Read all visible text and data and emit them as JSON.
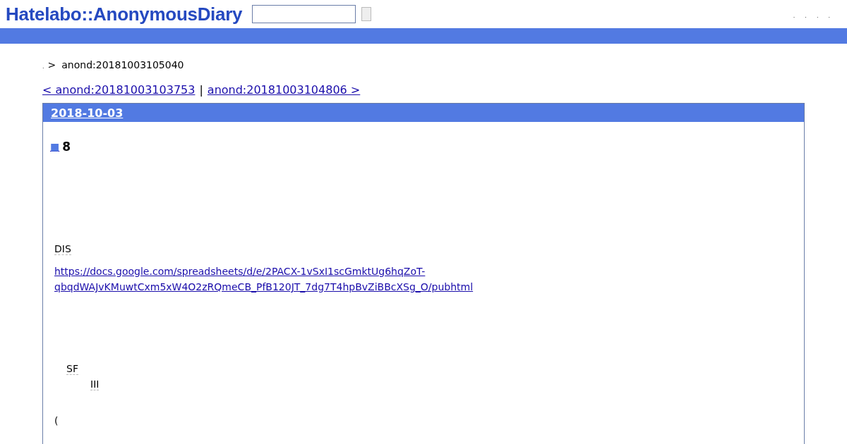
{
  "header": {
    "logo": "Hatelabo::AnonymousDiary",
    "menu": [
      ".",
      ".",
      ".",
      "."
    ]
  },
  "breadcrumb": {
    "home": ".",
    "separator": ">",
    "current": "anond:20181003105040"
  },
  "pager": {
    "prev": "< anond:20181003103753",
    "divider": "|",
    "next": "anond:20181003104806 >"
  },
  "day": {
    "date": "2018-10-03",
    "section": {
      "marker": "■",
      "title": "8"
    },
    "body": [
      {
        "kind": "keyword",
        "text": "DIS"
      },
      {
        "kind": "link",
        "text": "https://docs.google.com/spreadsheets/d/e/2PACX-1vSxI1scGmktUg6hqZoT-qbqdWAJvKMuwtCxm5xW4O2zRQmeCB_PfB120JT_7dg7T4hpBvZiBBcXSg_O/pubhtml"
      },
      {
        "kind": "list",
        "children": [
          {
            "text": "SF",
            "children": [
              {
                "text": "III"
              }
            ]
          }
        ]
      },
      {
        "kind": "text",
        "text": "("
      }
    ]
  }
}
